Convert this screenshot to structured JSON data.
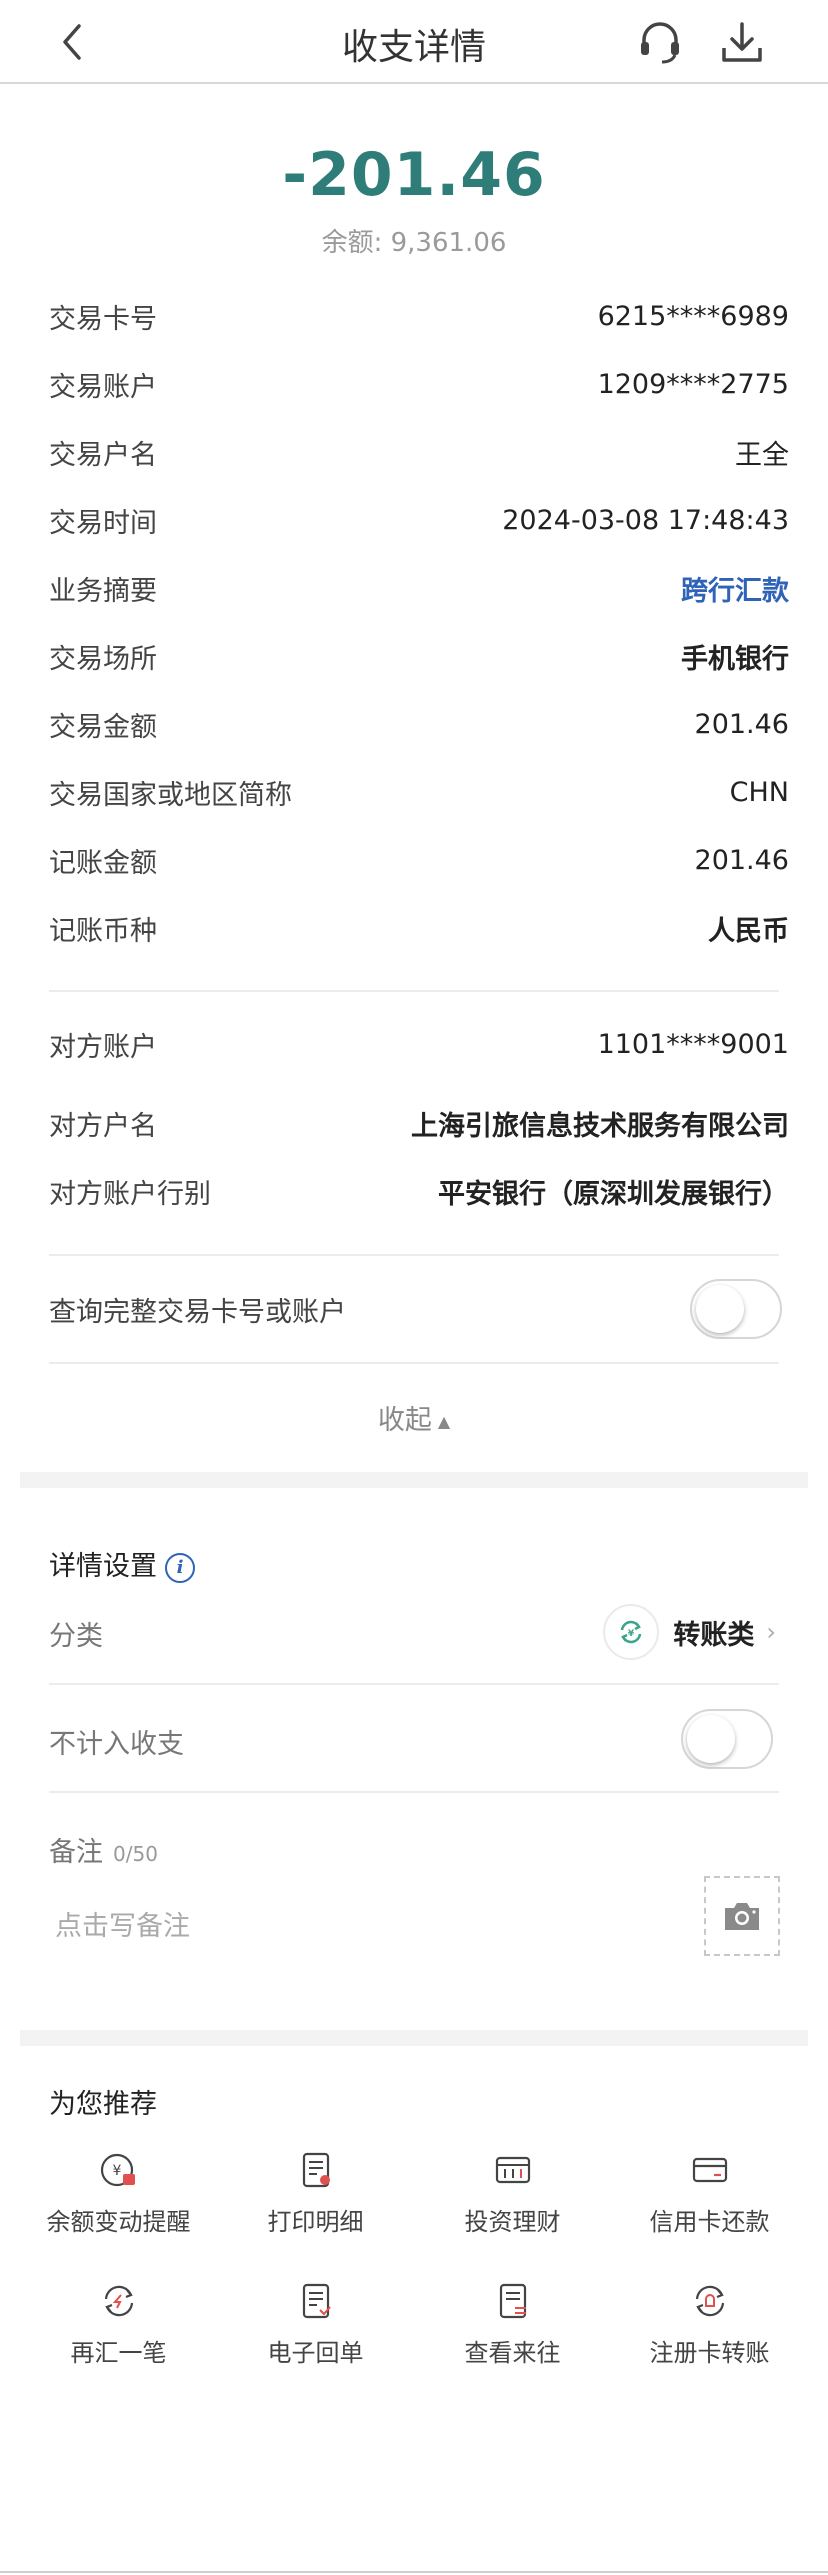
{
  "header": {
    "title": "收支详情"
  },
  "summary": {
    "amount": "-201.46",
    "balance": "余额: 9,361.06"
  },
  "details": [
    {
      "label": "交易卡号",
      "value": "6215****6989"
    },
    {
      "label": "交易账户",
      "value": "1209****2775"
    },
    {
      "label": "交易户名",
      "value": "王全"
    },
    {
      "label": "交易时间",
      "value": "2024-03-08 17:48:43"
    },
    {
      "label": "业务摘要",
      "value": "跨行汇款"
    },
    {
      "label": "交易场所",
      "value": "手机银行"
    },
    {
      "label": "交易金额",
      "value": "201.46"
    },
    {
      "label": "交易国家或地区简称",
      "value": "CHN"
    },
    {
      "label": "记账金额",
      "value": "201.46"
    },
    {
      "label": "记账币种",
      "value": "人民币"
    }
  ],
  "counterparty": [
    {
      "label": "对方账户",
      "value": "1101****9001"
    },
    {
      "label": "对方户名",
      "value": "上海引旅信息技术服务有限公司"
    },
    {
      "label": "对方账户行别",
      "value": "平安银行（原深圳发展银行）"
    }
  ],
  "query_full": {
    "label": "查询完整交易卡号或账户",
    "enabled": false
  },
  "collapse_label": "收起",
  "settings": {
    "title": "详情设置",
    "category_label": "分类",
    "category_value": "转账类",
    "exclude_label": "不计入收支",
    "exclude_enabled": false,
    "note_label": "备注",
    "note_count": "0/50",
    "note_placeholder": "点击写备注"
  },
  "recommend": {
    "title": "为您推荐",
    "items": [
      {
        "label": "余额变动提醒",
        "icon": "balance-alert-icon"
      },
      {
        "label": "打印明细",
        "icon": "print-detail-icon"
      },
      {
        "label": "投资理财",
        "icon": "investment-icon"
      },
      {
        "label": "信用卡还款",
        "icon": "credit-card-icon"
      },
      {
        "label": "再汇一笔",
        "icon": "remit-again-icon"
      },
      {
        "label": "电子回单",
        "icon": "e-receipt-icon"
      },
      {
        "label": "查看来往",
        "icon": "view-history-icon"
      },
      {
        "label": "注册卡转账",
        "icon": "registered-card-transfer-icon"
      }
    ]
  },
  "colors": {
    "amount": "#2e7d78",
    "link": "#2f62b8"
  }
}
